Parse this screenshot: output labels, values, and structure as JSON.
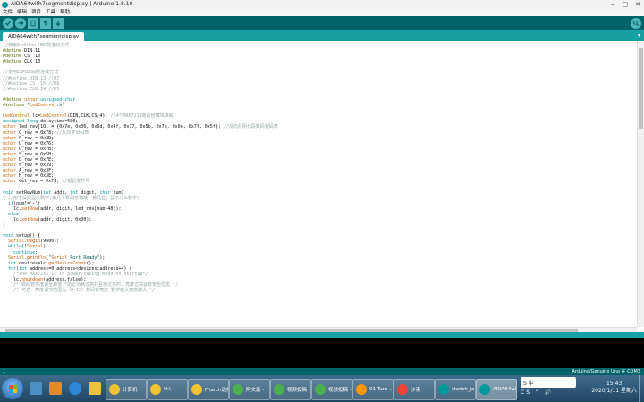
{
  "window": {
    "title": "AIDA64with7segmentdisplay | Arduino 1.8.10"
  },
  "menu": [
    "文件",
    "编辑",
    "项目",
    "工具",
    "帮助"
  ],
  "toolbar": {
    "buttons": [
      "verify-button",
      "upload-button",
      "new-button",
      "open-button",
      "save-button"
    ],
    "serial_monitor": "serial-monitor-button"
  },
  "tabs": [
    {
      "label": "AIDA64with7segmentdisplay"
    }
  ],
  "editor": {
    "code_lines": [
      "//使用Arduino UNO的连线方式",
      "#define DIN 11",
      "#define CS  10",
      "#define CLK 13",
      "",
      "//使用ESP8266的连线方式",
      "//#define DIN 13 //D7",
      "//#define CS  15 //D8",
      "//#define CLK 14 //D5",
      "",
      "#define uchar unsigned char",
      "#include \"LedControl.h\"",
      "",
      "LedControl lc=LedControl(DIN,CLK,CS,4); //4个MAX7219数码管模块级联",
      "unsigned long delaytime=500;",
      "uchar led_rev[10] = {0x7e, 0x06, 0x6d, 0x4f, 0x17, 0x5b, 0x7b, 0x0e, 0x7f, 0x5f}; //反向共阴七段数码管码表",
      "uchar C_rev = 0x78; //反向字母码表",
      "uchar P_rev = 0x3D;",
      "uchar U_rev = 0x76;",
      "uchar G_rev = 0x7B;",
      "uchar S_rev = 0x5B;",
      "uchar D_rev = 0x7E;",
      "uchar F_rev = 0x39;",
      "uchar A_rev = 0x3F;",
      "uchar H_rev = 0x3E;",
      "uchar Cel_rev = 0xF8; //摄氏度符号",
      "",
      "void setRevNum(int addr, int digit, char num)",
      "{ //用于反向显示数字(第几个数码管模块，第几位，显示什么数字)",
      "  if(num!='-')",
      "    lc.setRow(addr, digit, led_rev[num-48]);",
      "  else",
      "    lc.setRow(addr, digit, 0x00);",
      "}",
      "",
      "void setup() {",
      "  Serial.begin(9600);",
      "  while(!Serial)",
      "    continue;",
      "  Serial.println(\"Serial Port Ready\");",
      "  int devices=lc.getDeviceCount();",
      "  for(int address=0;address<devices;address++) {",
      "    /*The MAX72XX is in power-saving mode on startup*/",
      "    lc.shutdown(address,false);",
      "    /* 数码管亮度调至最低 *防止功耗过高并且接过多时，亮度过高会有安全隐患 */",
      "    /* 可选：亮度调节范围为（0-15）数码管亮度 数字越大亮度越大 */"
    ]
  },
  "statusbar": {
    "line": "1",
    "board": "Arduino/Genuino Uno 在 COM3"
  },
  "taskbar": {
    "pinned": [
      "explorer-icon",
      "media-player-icon",
      "store-icon",
      "ie-icon",
      "folder-icon"
    ],
    "tasks": [
      {
        "label": "计算机",
        "icon_color": "#f1c232",
        "active": false
      },
      {
        "label": "H:\\",
        "icon_color": "#f1c232",
        "active": false
      },
      {
        "label": "F:\\arch选择",
        "icon_color": "#f1c232",
        "active": false
      },
      {
        "label": "阿文鑫 -",
        "icon_color": "#4caf50",
        "active": false
      },
      {
        "label": "视频投稿 -",
        "icon_color": "#4caf50",
        "active": false
      },
      {
        "label": "视频投稿 -",
        "icon_color": "#4caf50",
        "active": false
      },
      {
        "label": "01 Turn ...",
        "icon_color": "#ff9800",
        "active": false
      },
      {
        "label": "沙漠",
        "icon_color": "#f44336",
        "active": false
      },
      {
        "label": "sketch_ja...",
        "icon_color": "#00979c",
        "active": false
      },
      {
        "label": "AIDA64wi...",
        "icon_color": "#00979c",
        "active": true
      }
    ],
    "clock": {
      "time": "15:43",
      "date": "2020/1/11 星期六"
    },
    "ime": "S 中"
  }
}
